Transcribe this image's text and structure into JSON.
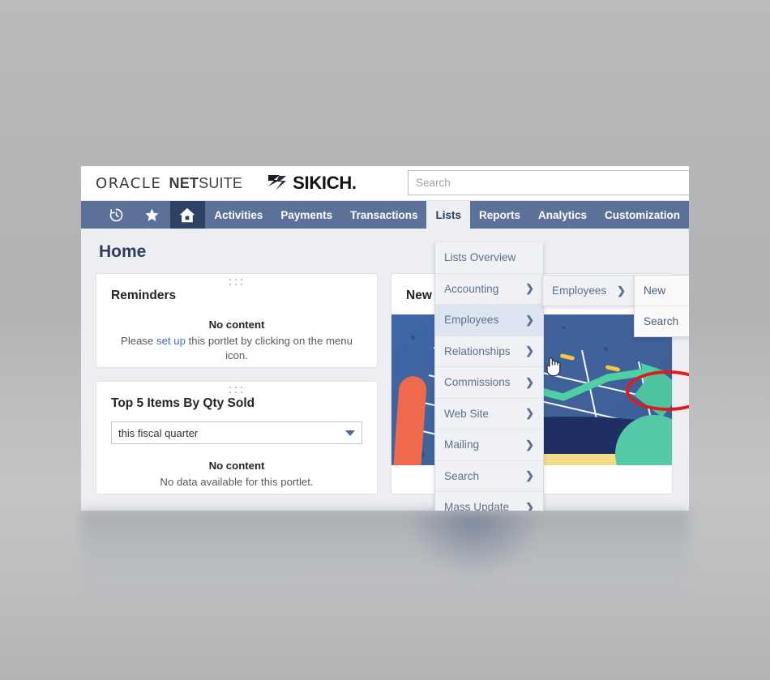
{
  "brand": {
    "oracle": "ORACLE",
    "netsuite_bold": "NET",
    "netsuite_light": "SUITE",
    "partner": "SIKICH",
    "partner_dot": "."
  },
  "search": {
    "placeholder": "Search",
    "value": ""
  },
  "nav": {
    "icons": [
      {
        "name": "history-icon",
        "label": "Recent Records"
      },
      {
        "name": "star-icon",
        "label": "Shortcuts"
      },
      {
        "name": "home-icon",
        "label": "Home"
      }
    ],
    "items": [
      {
        "label": "Activities",
        "active": false
      },
      {
        "label": "Payments",
        "active": false
      },
      {
        "label": "Transactions",
        "active": false
      },
      {
        "label": "Lists",
        "active": true
      },
      {
        "label": "Reports",
        "active": false
      },
      {
        "label": "Analytics",
        "active": false
      },
      {
        "label": "Customization",
        "active": false
      }
    ]
  },
  "page": {
    "title": "Home"
  },
  "portlets": {
    "reminders": {
      "title": "Reminders",
      "empty_heading": "No content",
      "empty_text_before": "Please ",
      "empty_link": "set up",
      "empty_text_after": " this portlet by clicking on the menu icon."
    },
    "top_items": {
      "title": "Top 5 Items By Qty Sold",
      "period_value": "this fiscal quarter",
      "empty_heading": "No content",
      "empty_text": "No data available for this portlet."
    },
    "new_portlet": {
      "title": "New"
    }
  },
  "menus": {
    "lists_dropdown": [
      {
        "label": "Lists Overview",
        "has_arrow": false,
        "highlighted": false
      },
      {
        "label": "Accounting",
        "has_arrow": true,
        "highlighted": false
      },
      {
        "label": "Employees",
        "has_arrow": true,
        "highlighted": true
      },
      {
        "label": "Relationships",
        "has_arrow": true,
        "highlighted": false
      },
      {
        "label": "Commissions",
        "has_arrow": true,
        "highlighted": false
      },
      {
        "label": "Web Site",
        "has_arrow": true,
        "highlighted": false
      },
      {
        "label": "Mailing",
        "has_arrow": true,
        "highlighted": false
      },
      {
        "label": "Search",
        "has_arrow": true,
        "highlighted": false
      },
      {
        "label": "Mass Update",
        "has_arrow": true,
        "highlighted": false
      }
    ],
    "employees_submenu": [
      {
        "label": "Employees",
        "has_arrow": true
      }
    ],
    "employees_actions": [
      {
        "label": "New",
        "annotated": false
      },
      {
        "label": "Search",
        "annotated": true
      }
    ]
  },
  "annotation": {
    "target": "Search",
    "shape": "ellipse",
    "color": "#e01b1b"
  },
  "colors": {
    "nav_bar": "#5b7198",
    "nav_home_tab": "#2e4263",
    "page_background": "#eceef2",
    "menu_text": "#5d718f",
    "menu_highlight": "#dde5f2",
    "link": "#3b6fbf",
    "annotation": "#e01b1b"
  }
}
